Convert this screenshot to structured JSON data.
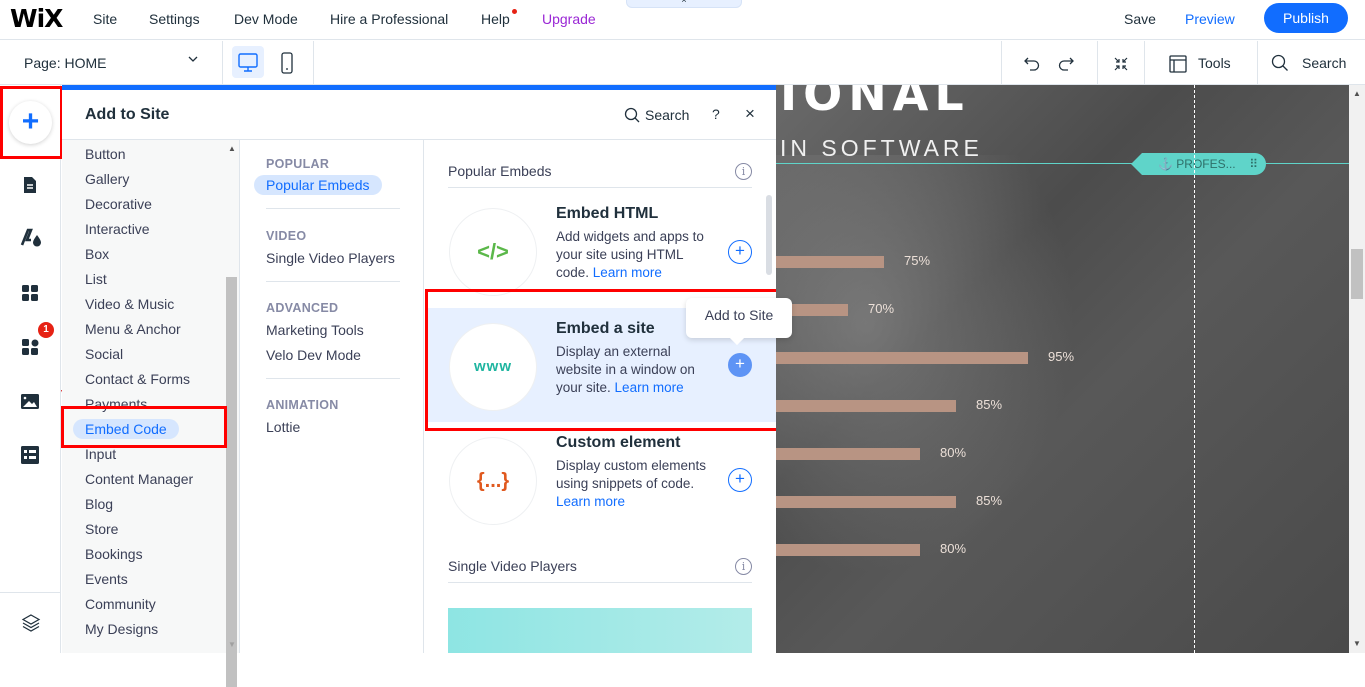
{
  "topbar": {
    "logo": "WiX",
    "menu": [
      "Site",
      "Settings",
      "Dev Mode",
      "Hire a Professional",
      "Help",
      "Upgrade"
    ],
    "drop_tab_icon": "×",
    "save": "Save",
    "preview": "Preview",
    "publish": "Publish"
  },
  "toolbar": {
    "page_selector": "Page: HOME",
    "tools": "Tools",
    "search": "Search"
  },
  "rail": {
    "add_icon": "+",
    "notification_count": "1"
  },
  "panel": {
    "title": "Add to Site",
    "search": "Search",
    "help": "?",
    "close": "×",
    "categories": [
      "Button",
      "Gallery",
      "Decorative",
      "Interactive",
      "Box",
      "List",
      "Video & Music",
      "Menu & Anchor",
      "Social",
      "Contact & Forms",
      "Payments",
      "Embed Code",
      "Input",
      "Content Manager",
      "Blog",
      "Store",
      "Bookings",
      "Events",
      "Community",
      "My Designs"
    ],
    "active_category": "Embed Code",
    "subcategories": [
      {
        "heading": "POPULAR",
        "items": [
          "Popular Embeds"
        ]
      },
      {
        "heading": "VIDEO",
        "items": [
          "Single Video Players"
        ]
      },
      {
        "heading": "ADVANCED",
        "items": [
          "Marketing Tools",
          "Velo Dev Mode"
        ]
      },
      {
        "heading": "ANIMATION",
        "items": [
          "Lottie"
        ]
      }
    ],
    "active_subcategory": "Popular Embeds",
    "sections": [
      {
        "title": "Popular Embeds",
        "info": "i"
      },
      {
        "title": "Single Video Players",
        "info": "i"
      }
    ],
    "items": [
      {
        "icon_text": "</>",
        "icon_color": "#5bb84a",
        "title": "Embed HTML",
        "desc": "Add widgets and apps to your site using HTML code.",
        "link": "Learn more"
      },
      {
        "icon_text": "www",
        "icon_color": "#1fb5a0",
        "title": "Embed a site",
        "desc": "Display an external website in a window on your site.",
        "link": "Learn more"
      },
      {
        "icon_text": "{...}",
        "icon_color": "#e0591f",
        "title": "Custom element",
        "desc": "Display custom elements using snippets of code.",
        "link": "Learn more"
      }
    ],
    "add_icon": "+",
    "tooltip": "Add to Site"
  },
  "canvas": {
    "headline": "IONAL",
    "subline": "IN SOFTWARE",
    "anchor_label": "PROFES...",
    "anchor_drag_icon": "⠿",
    "skills": [
      {
        "percent": 75,
        "label": "75%"
      },
      {
        "percent": 70,
        "label": "70%"
      },
      {
        "percent": 95,
        "label": "95%"
      },
      {
        "percent": 85,
        "label": "85%"
      },
      {
        "percent": 80,
        "label": "80%"
      },
      {
        "percent": 85,
        "label": "85%"
      },
      {
        "percent": 80,
        "label": "80%"
      }
    ]
  },
  "colors": {
    "accent": "#116dff",
    "upgrade": "#9a27d5",
    "highlight_box": "#ff0000",
    "anchor": "#5fd4c9",
    "bar": "#b89483"
  }
}
